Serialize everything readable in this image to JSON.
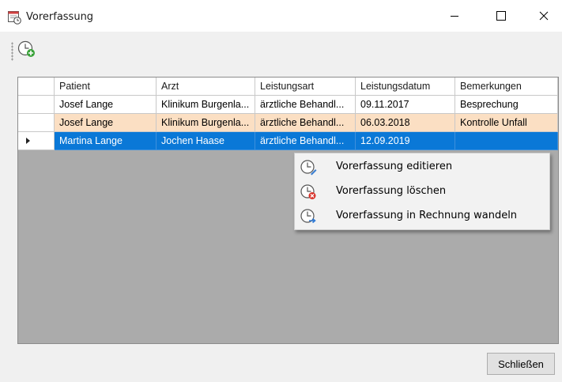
{
  "window": {
    "title": "Vorerfassung",
    "controls": {
      "minimize": "–",
      "maximize": "☐",
      "close": "✕"
    },
    "app_icon": "calendar-clock-icon"
  },
  "toolbar": {
    "items": [
      {
        "icon": "clock-add-icon"
      }
    ]
  },
  "grid": {
    "columns": [
      "Patient",
      "Arzt",
      "Leistungsart",
      "Leistungsdatum",
      "Bemerkungen"
    ],
    "rows": [
      {
        "cells": [
          "Josef Lange",
          "Klinikum Burgenla...",
          "ärztliche Behandl...",
          "09.11.2017",
          "Besprechung"
        ],
        "state": "normal"
      },
      {
        "cells": [
          "Josef Lange",
          "Klinikum Burgenla...",
          "ärztliche Behandl...",
          "06.03.2018",
          "Kontrolle Unfall"
        ],
        "state": "highlighted"
      },
      {
        "cells": [
          "Martina Lange",
          "Jochen Haase",
          "ärztliche Behandl...",
          "12.09.2019",
          ""
        ],
        "state": "selected"
      }
    ]
  },
  "context_menu": {
    "items": [
      {
        "label": "Vorerfassung editieren",
        "icon": "clock-edit-icon"
      },
      {
        "label": "Vorerfassung löschen",
        "icon": "clock-delete-icon"
      },
      {
        "label": "Vorerfassung in Rechnung wandeln",
        "icon": "clock-convert-icon"
      }
    ]
  },
  "footer": {
    "close_label": "Schließen"
  },
  "colors": {
    "selection": "#0a78d7",
    "highlight_row": "#fbdfc3",
    "grid_background": "#ababab",
    "window_background": "#f0f0f0"
  }
}
